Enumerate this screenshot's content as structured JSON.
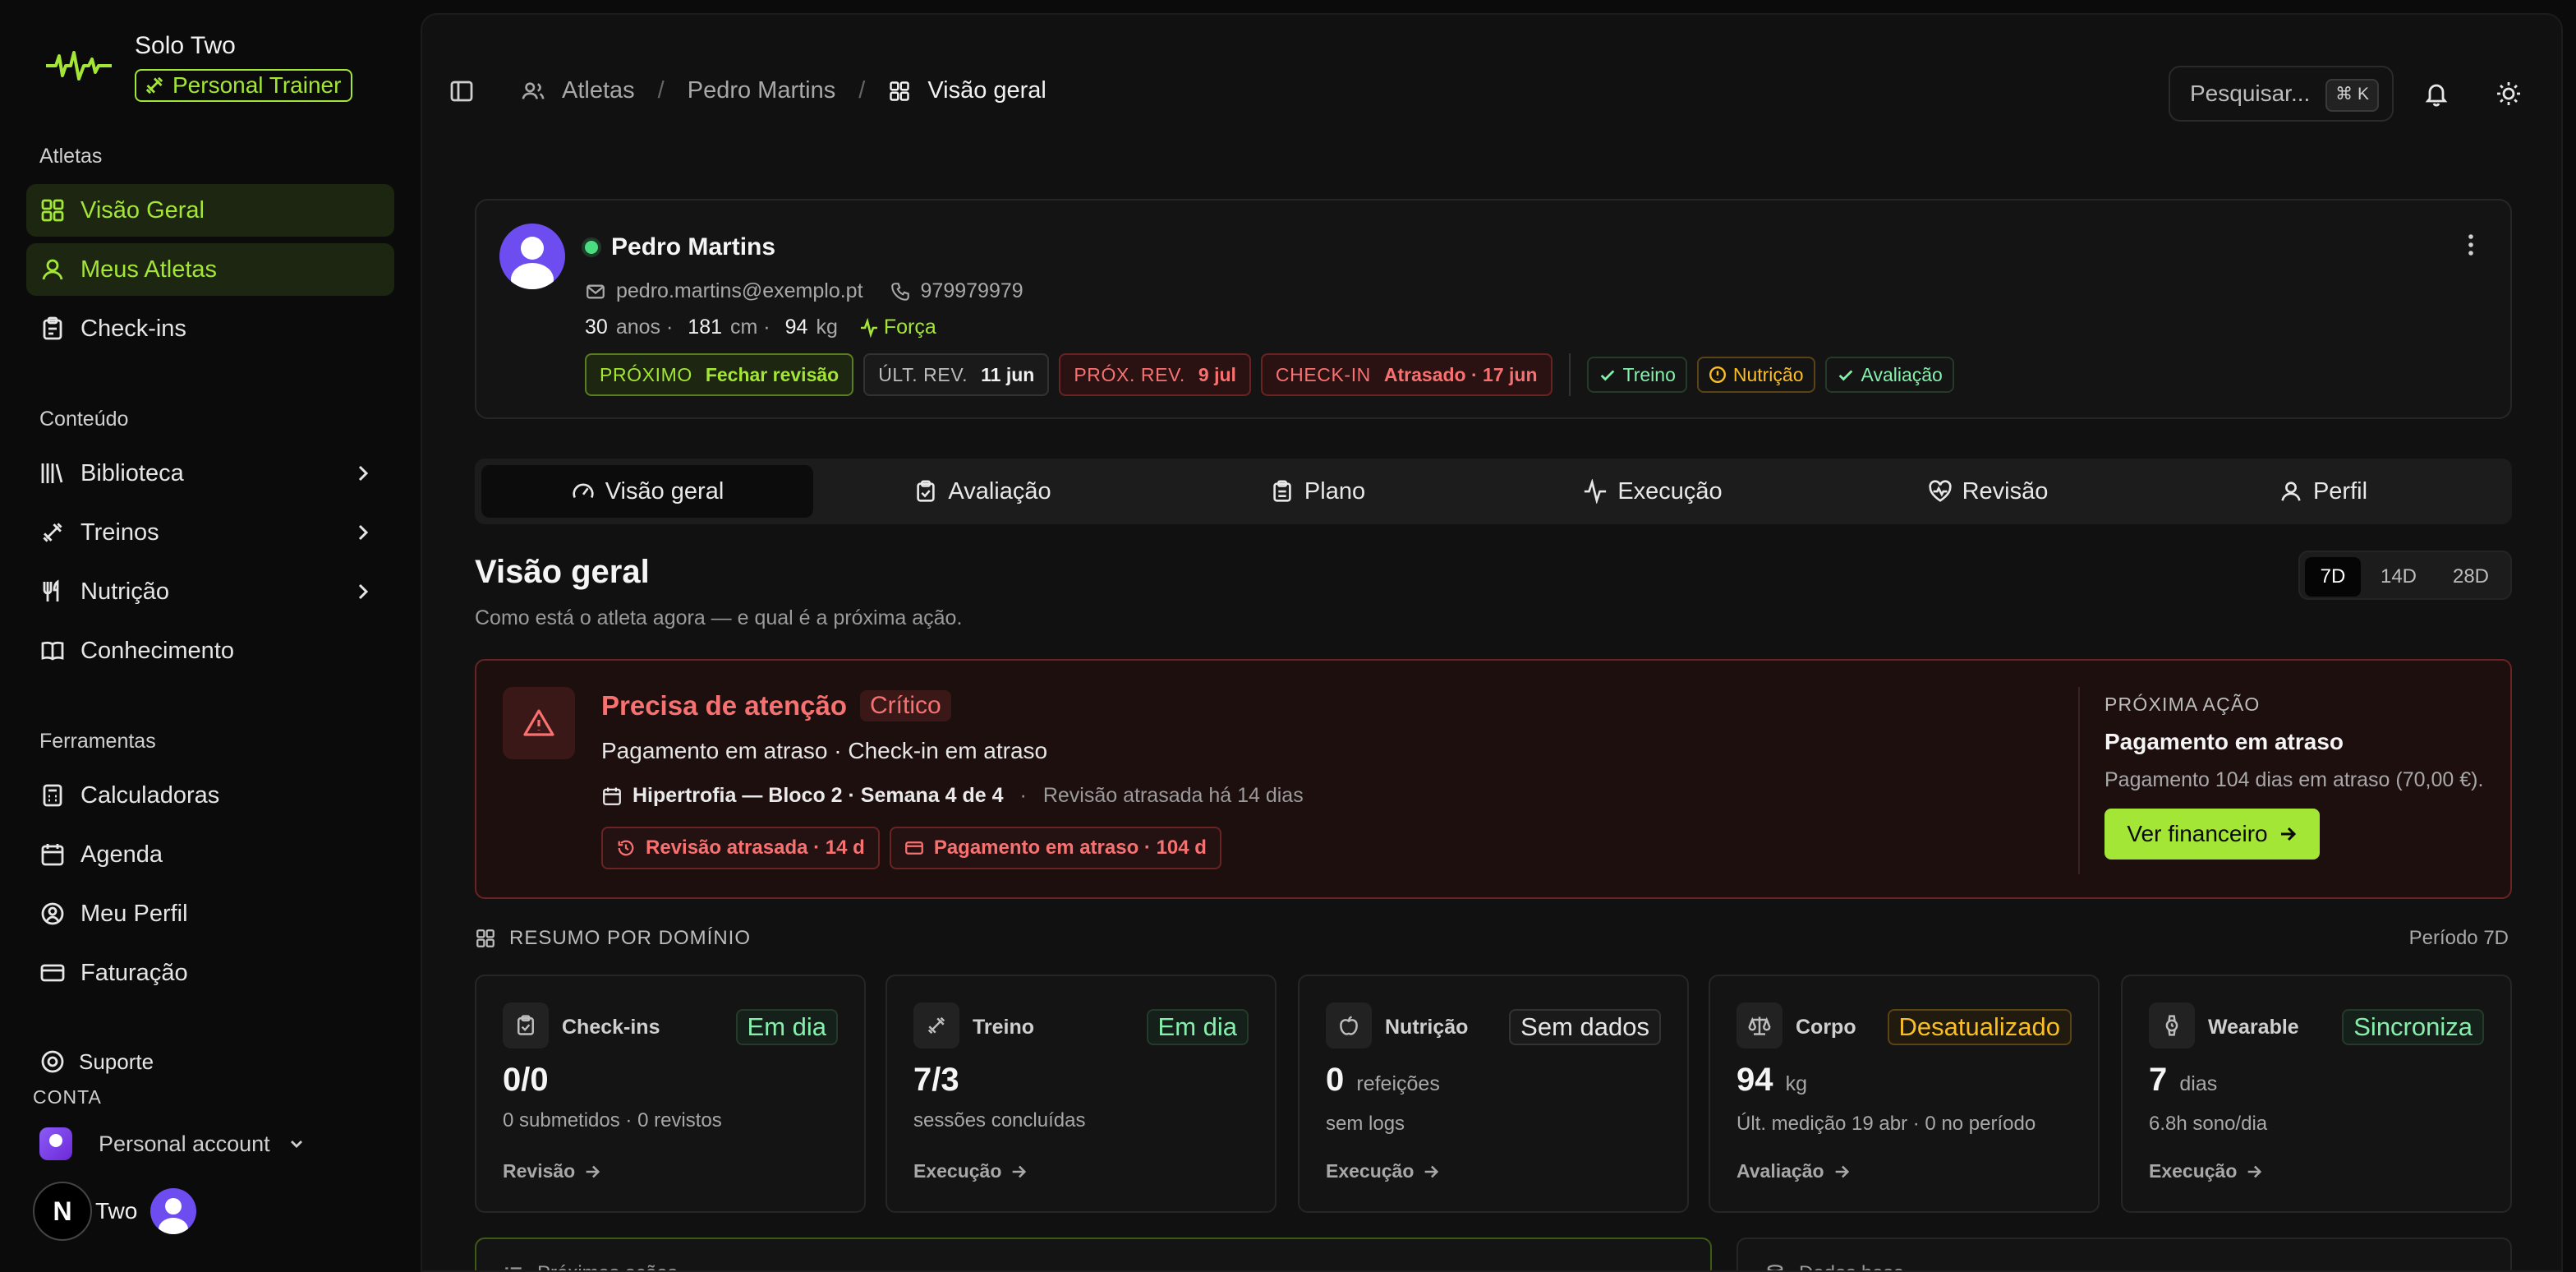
{
  "app": {
    "name": "Solo Two",
    "role_badge": "Personal Trainer"
  },
  "sidebar": {
    "sections": [
      {
        "label": "Atletas",
        "items": [
          {
            "label": "Visão Geral",
            "icon": "grid-icon",
            "active": true
          },
          {
            "label": "Meus Atletas",
            "icon": "user-icon",
            "active": true
          },
          {
            "label": "Check-ins",
            "icon": "clipboard-icon",
            "active": false
          }
        ]
      },
      {
        "label": "Conteúdo",
        "items": [
          {
            "label": "Biblioteca",
            "icon": "library-icon"
          },
          {
            "label": "Treinos",
            "icon": "dumbbell-icon"
          },
          {
            "label": "Nutrição",
            "icon": "utensils-icon"
          },
          {
            "label": "Conhecimento",
            "icon": "book-icon"
          }
        ]
      },
      {
        "label": "Ferramentas",
        "items": [
          {
            "label": "Calculadoras",
            "icon": "calculator-icon"
          },
          {
            "label": "Agenda",
            "icon": "calendar-icon"
          },
          {
            "label": "Meu Perfil",
            "icon": "user-circle-icon"
          },
          {
            "label": "Faturação",
            "icon": "credit-card-icon"
          }
        ]
      }
    ],
    "support": "Suporte",
    "conta_label": "CONTA",
    "account": "Personal account",
    "footer_user": "Two",
    "footer_badge": "N"
  },
  "breadcrumb": {
    "items": [
      "Atletas",
      "Pedro Martins",
      "Visão geral"
    ]
  },
  "search": {
    "placeholder": "Pesquisar...",
    "shortcut": "⌘ K"
  },
  "athlete": {
    "name": "Pedro Martins",
    "email": "pedro.martins@exemplo.pt",
    "phone": "979979979",
    "age": "30",
    "age_unit": "anos ·",
    "height": "181",
    "height_unit": "cm ·",
    "weight": "94",
    "weight_unit": "kg",
    "focus": "Força",
    "chips": [
      {
        "key": "PRÓXIMO",
        "value": "Fechar revisão",
        "tone": "green"
      },
      {
        "key": "ÚLT. REV.",
        "value": "11 jun",
        "tone": "neutral"
      },
      {
        "key": "PRÓX. REV.",
        "value": "9 jul",
        "tone": "red"
      },
      {
        "key": "CHECK-IN",
        "value": "Atrasado · 17 jun",
        "tone": "red"
      }
    ],
    "statuses": [
      {
        "label": "Treino",
        "tone": "ok"
      },
      {
        "label": "Nutrição",
        "tone": "warn"
      },
      {
        "label": "Avaliação",
        "tone": "ok"
      }
    ]
  },
  "tabs": [
    "Visão geral",
    "Avaliação",
    "Plano",
    "Execução",
    "Revisão",
    "Perfil"
  ],
  "overview": {
    "title": "Visão geral",
    "subtitle": "Como está o atleta agora — e qual é a próxima ação.",
    "ranges": [
      "7D",
      "14D",
      "28D"
    ],
    "selected_range": "7D"
  },
  "alert": {
    "title": "Precisa de atenção",
    "severity": "Crítico",
    "summary": "Pagamento em atraso · Check-in em atraso",
    "plan": "Hipertrofia — Bloco 2 · Semana 4 de 4",
    "plan_note": "Revisão atrasada há 14 dias",
    "chips": [
      "Revisão atrasada · 14 d",
      "Pagamento em atraso · 104 d"
    ],
    "next_action": {
      "label": "PRÓXIMA AÇÃO",
      "title": "Pagamento em atraso",
      "desc": "Pagamento 104 dias em atraso (70,00 €).",
      "button": "Ver financeiro"
    }
  },
  "summary": {
    "title": "RESUMO POR DOMÍNIO",
    "period": "Período 7D",
    "cards": [
      {
        "name": "Check-ins",
        "badge": "Em dia",
        "tone": "ok",
        "value": "0/0",
        "unit": "",
        "sub": "0 submetidos · 0 revistos",
        "link": "Revisão"
      },
      {
        "name": "Treino",
        "badge": "Em dia",
        "tone": "ok",
        "value": "7/3",
        "unit": "",
        "sub": "sessões concluídas",
        "link": "Execução"
      },
      {
        "name": "Nutrição",
        "badge": "Sem dados",
        "tone": "none",
        "value": "0",
        "unit": "refeições",
        "sub": "sem logs",
        "link": "Execução"
      },
      {
        "name": "Corpo",
        "badge": "Desatualizado",
        "tone": "warn",
        "value": "94",
        "unit": "kg",
        "sub": "Últ. medição 19 abr · 0 no período",
        "link": "Avaliação"
      },
      {
        "name": "Wearable",
        "badge": "Sincroniza",
        "tone": "ok",
        "value": "7",
        "unit": "dias",
        "sub": "6.8h sono/dia",
        "link": "Execução"
      }
    ]
  },
  "bottom": {
    "left": "Próximas ações",
    "right": "Dados base"
  }
}
